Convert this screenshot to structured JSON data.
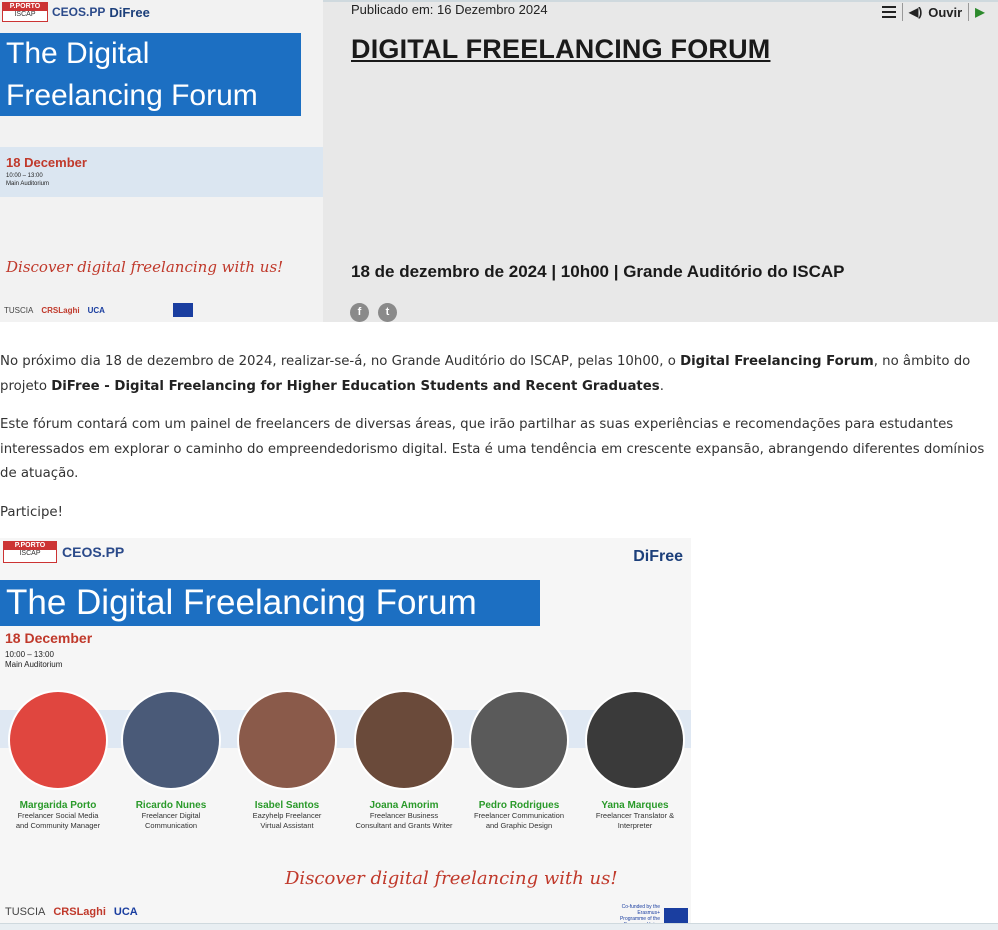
{
  "header": {
    "published": "Publicado em: 16 Dezembro 2024",
    "title": "DIGITAL FREELANCING FORUM",
    "when": "18 de dezembro de 2024 | 10h00 | Grande Auditório do ISCAP",
    "listen_label": "Ouvir",
    "share": {
      "facebook": "f",
      "twitter": "t"
    }
  },
  "thumbnail": {
    "pporto_top": "P.PORTO",
    "pporto_bottom": "ISCAP",
    "ceos": "CEOS.PP",
    "difree": "DiFree",
    "banner_line1": "The Digital",
    "banner_line2": "Freelancing Forum",
    "date": "18 December",
    "time": "10:00 – 13:00",
    "room": "Main Auditorium",
    "slogan": "Discover digital freelancing with us!",
    "partner1": "TUSCIA",
    "partner2": "CRSLaghi",
    "partner3": "UCA"
  },
  "body": {
    "p1_a": "No próximo dia 18 de dezembro de 2024, realizar-se-á, no Grande Auditório do ISCAP, pelas 10h00, o ",
    "p1_b": "Digital Freelancing Forum",
    "p1_c": ", no âmbito do projeto ",
    "p1_d": "DiFree - Digital Freelancing for Higher Education Students and Recent Graduates",
    "p1_e": ".",
    "p2": "Este fórum contará com um painel de freelancers de diversas áreas, que irão partilhar as suas experiências e recomendações para estudantes interessados em explorar o caminho do empreendedorismo digital. Esta é uma tendência em crescente expansão, abrangendo diferentes domínios de atuação.",
    "p3": "Participe!"
  },
  "poster": {
    "pporto_top": "P.PORTO",
    "pporto_bottom": "ISCAP",
    "ceos": "CEOS.PP",
    "difree": "DiFree",
    "banner": "The Digital Freelancing Forum",
    "date": "18 December",
    "time": "10:00 – 13:00",
    "room": "Main Auditorium",
    "slogan": "Discover digital freelancing with us!",
    "partner1": "TUSCIA",
    "partner2": "CRSLaghi",
    "partner3": "UCA",
    "eu_text": "Co-funded by the Erasmus+ Programme of the European Union",
    "speakers": [
      {
        "name": "Margarida Porto",
        "role1": "Freelancer Social Media",
        "role2": "and Community Manager",
        "color": "#e0463f"
      },
      {
        "name": "Ricardo Nunes",
        "role1": "Freelancer Digital",
        "role2": "Communication",
        "color": "#4a5a78"
      },
      {
        "name": "Isabel Santos",
        "role1": "Eazyhelp Freelancer",
        "role2": "Virtual Assistant",
        "color": "#8a5a4a"
      },
      {
        "name": "Joana Amorim",
        "role1": "Freelancer Business",
        "role2": "Consultant and Grants Writer",
        "color": "#6a4a3a"
      },
      {
        "name": "Pedro Rodrigues",
        "role1": "Freelancer Communication",
        "role2": "and Graphic Design",
        "color": "#5a5a5a"
      },
      {
        "name": "Yana Marques",
        "role1": "Freelancer Translator &",
        "role2": "Interpreter",
        "color": "#3a3a3a"
      }
    ]
  },
  "colors": {
    "accent_blue": "#1c6fc2",
    "accent_red": "#c0392b",
    "speaker_green": "#2a9a2a"
  }
}
